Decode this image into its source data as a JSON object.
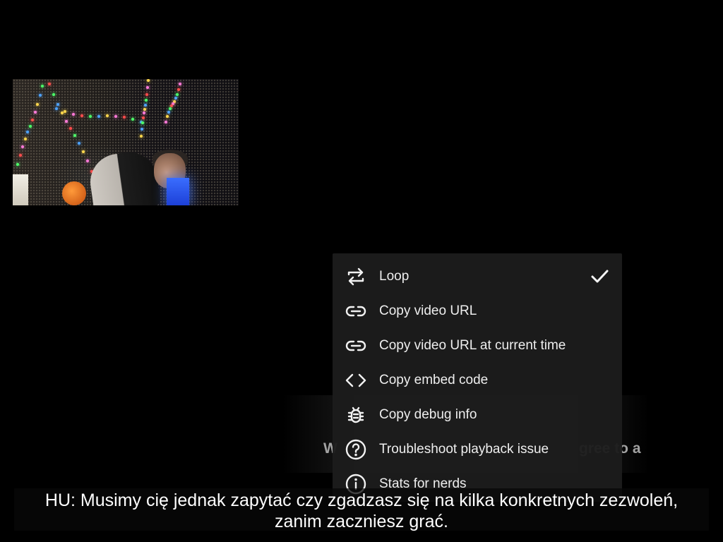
{
  "video": {
    "frame_label": "video-frame"
  },
  "background_caption": {
    "left_text": "W",
    "right_text": "gree to a"
  },
  "context_menu": {
    "items": [
      {
        "label": "Loop",
        "icon": "loop-icon",
        "checked": true
      },
      {
        "label": "Copy video URL",
        "icon": "link-icon",
        "checked": false
      },
      {
        "label": "Copy video URL at current time",
        "icon": "link-icon",
        "checked": false
      },
      {
        "label": "Copy embed code",
        "icon": "embed-code-icon",
        "checked": false
      },
      {
        "label": "Copy debug info",
        "icon": "bug-icon",
        "checked": false
      },
      {
        "label": "Troubleshoot playback issue",
        "icon": "question-icon",
        "checked": false
      },
      {
        "label": "Stats for nerds",
        "icon": "info-icon",
        "checked": false
      }
    ]
  },
  "subtitle": {
    "line1": "HU: Musimy cię jednak zapytać czy zgadzasz się na kilka konkretnych zezwoleń,",
    "line2": "zanim zaczniesz grać."
  }
}
